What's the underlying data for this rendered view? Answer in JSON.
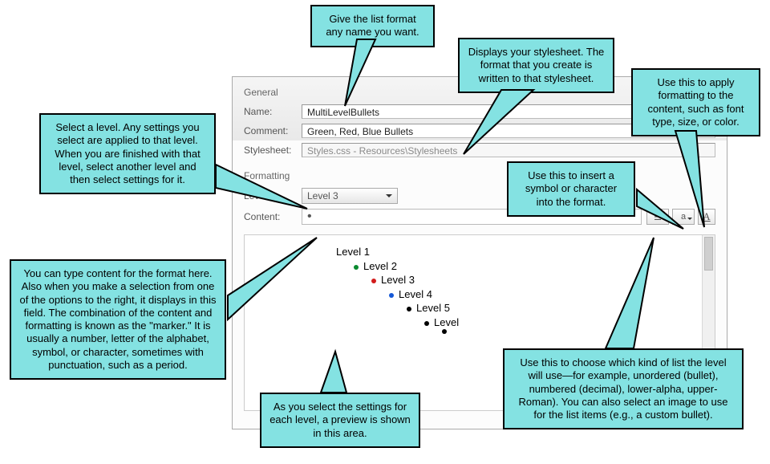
{
  "dialog": {
    "section_general": "General",
    "name_label": "Name:",
    "name_value": "MultiLevelBullets",
    "comment_label": "Comment:",
    "comment_value": "Green, Red, Blue Bullets",
    "stylesheet_label": "Stylesheet:",
    "stylesheet_value": "Styles.css - Resources\\Stylesheets",
    "section_formatting": "Formatting",
    "level_label": "Level:",
    "level_value": "Level 3",
    "content_label": "Content:",
    "content_value": "•"
  },
  "preview": {
    "items": [
      "Level 1",
      "Level 2",
      "Level 3",
      "Level 4",
      "Level 5",
      "Level"
    ]
  },
  "callouts": {
    "name_any": "Give the list format any name you want.",
    "stylesheet": "Displays your stylesheet. The format that you create is written to that stylesheet.",
    "font_format": "Use this to apply formatting to the content, such as font type, size, or color.",
    "select_level": "Select a level. Any settings you select are applied to that level. When you are finished with that level, select another level and then select settings for it.",
    "insert_symbol": "Use this to insert a symbol or character into the format.",
    "content_info": "You can type content for the format here. Also when you make a selection from one of the options to the right, it displays in this field. The combination of the content and formatting is known as the \"marker.\" It is usually a number, letter of the alphabet, symbol, or character, sometimes with punctuation, such as a period.",
    "preview_info": "As you select the settings for each level, a preview is shown in this area.",
    "list_type": "Use this to choose which kind of list the level will use—for example, unordered (bullet), numbered (decimal), lower-alpha, upper-Roman). You can also select an image to use for the list items (e.g., a custom bullet)."
  }
}
